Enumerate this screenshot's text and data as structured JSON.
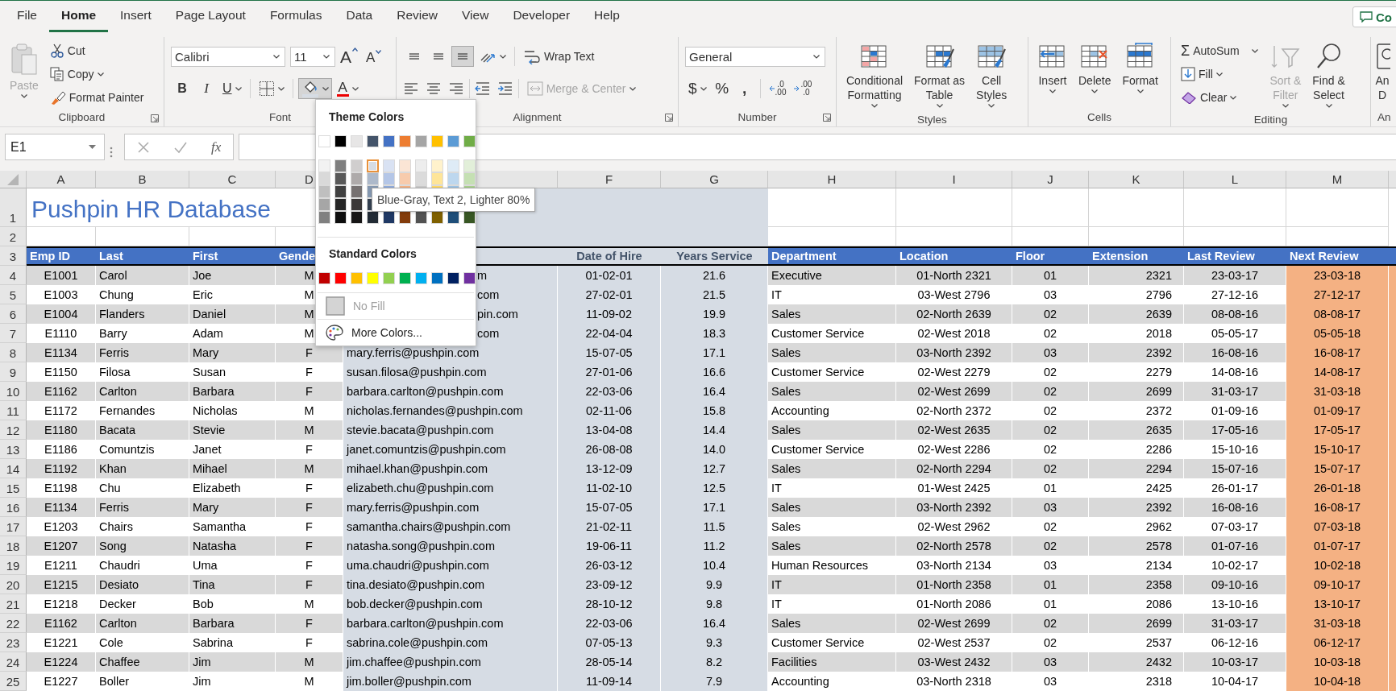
{
  "tabs": [
    {
      "label": "File",
      "selected": false
    },
    {
      "label": "Home",
      "selected": true
    },
    {
      "label": "Insert",
      "selected": false
    },
    {
      "label": "Page Layout",
      "selected": false
    },
    {
      "label": "Formulas",
      "selected": false
    },
    {
      "label": "Data",
      "selected": false
    },
    {
      "label": "Review",
      "selected": false
    },
    {
      "label": "View",
      "selected": false
    },
    {
      "label": "Developer",
      "selected": false
    },
    {
      "label": "Help",
      "selected": false
    }
  ],
  "comments_button": "Co",
  "clipboard": {
    "label": "Clipboard",
    "paste": {
      "label": "Paste",
      "disabled": true
    },
    "cut": "Cut",
    "copy": "Copy",
    "format_painter": "Format Painter"
  },
  "font": {
    "label": "Font",
    "font_name": "Calibri",
    "font_size": "11",
    "grow": "A",
    "shrink": "A",
    "bold": "B",
    "italic": "I",
    "underline": "U",
    "fill_color": {
      "pressed": true
    },
    "font_color": "A"
  },
  "alignment": {
    "label": "Alignment",
    "vertical": [
      {
        "selected": false
      },
      {
        "selected": false
      },
      {
        "selected": true
      }
    ],
    "wrap_text": "Wrap Text",
    "merge": {
      "label": "Merge & Center",
      "disabled": true
    }
  },
  "number": {
    "label": "Number",
    "format": "General",
    "currency": "$",
    "percent": "%",
    "comma": ",",
    "decimals": [
      {
        "top": ".0",
        "bottom": ".00"
      },
      {
        "top": ".00",
        "bottom": ".0"
      }
    ]
  },
  "styles": {
    "label": "Styles",
    "buttons": [
      {
        "lines": [
          "Conditional",
          "Formatting"
        ]
      },
      {
        "lines": [
          "Format as",
          "Table"
        ]
      },
      {
        "lines": [
          "Cell",
          "Styles"
        ]
      }
    ]
  },
  "cells": {
    "label": "Cells",
    "buttons": [
      "Insert",
      "Delete",
      "Format"
    ]
  },
  "editing": {
    "label": "Editing",
    "sigma": "Σ",
    "autosum": "AutoSum",
    "fill": "Fill",
    "clear": "Clear",
    "sort": {
      "lines": [
        "Sort &",
        "Filter"
      ],
      "disabled": true
    },
    "find": {
      "lines": [
        "Find &",
        "Select"
      ],
      "disabled": false
    }
  },
  "analyze": {
    "lines": [
      "An",
      "D"
    ],
    "label": "An"
  },
  "formula_bar": {
    "name_box": "E1",
    "fx": "fx"
  },
  "sheet": {
    "columns": [
      {
        "letter": "A"
      },
      {
        "letter": "B"
      },
      {
        "letter": "C"
      },
      {
        "letter": "D"
      },
      {
        "kind": "filled",
        "color": "#d6dce4"
      },
      {
        "letter": "F",
        "kind": "filled",
        "color": "#d6dce4"
      },
      {
        "letter": "G",
        "kind": "filled",
        "color": "#d6dce4"
      },
      {
        "letter": "H"
      },
      {
        "letter": "I"
      },
      {
        "letter": "J"
      },
      {
        "letter": "K"
      },
      {
        "letter": "L"
      },
      {
        "letter": "M",
        "kind": "highlighted",
        "color": "#f4b183"
      }
    ],
    "rows": [
      {
        "number": "1",
        "kind": "title",
        "title": "Pushpin HR Database"
      },
      {
        "number": "2",
        "kind": "blank"
      },
      {
        "number": "3",
        "kind": "header",
        "cells_before_menu": [
          "Emp ID",
          "Last",
          "First",
          "Gende"
        ],
        "cells_after_menu": [
          "Date of Hire",
          "Years Service",
          "Department",
          "Location",
          "Floor",
          "Extension",
          "Last Review",
          "Next Review"
        ]
      },
      {
        "number": "4",
        "kind": "data",
        "shaded": true,
        "cells": [
          "E1001",
          "Carol",
          "Joe",
          "M",
          {
            "covered": true,
            "text": "m"
          },
          "01-02-01",
          "21.6",
          "Executive",
          "01-North 2321",
          "01",
          "2321",
          "23-03-17",
          "23-03-18"
        ]
      },
      {
        "number": "5",
        "kind": "data",
        "shaded": false,
        "cells": [
          "E1003",
          "Chung",
          "Eric",
          "M",
          {
            "covered": true,
            "text": "com"
          },
          "27-02-01",
          "21.5",
          "IT",
          "03-West 2796",
          "03",
          "2796",
          "27-12-16",
          "27-12-17"
        ]
      },
      {
        "number": "6",
        "kind": "data",
        "shaded": true,
        "cells": [
          "E1004",
          "Flanders",
          "Daniel",
          "M",
          {
            "covered": true,
            "text": "pin.com"
          },
          "11-09-02",
          "19.9",
          "Sales",
          "02-North 2639",
          "02",
          "2639",
          "08-08-16",
          "08-08-17"
        ]
      },
      {
        "number": "7",
        "kind": "data",
        "shaded": false,
        "cells": [
          "E1110",
          "Barry",
          "Adam",
          "M",
          {
            "covered": true,
            "text": "com"
          },
          "22-04-04",
          "18.3",
          "Customer Service",
          "02-West 2018",
          "02",
          "2018",
          "05-05-17",
          "05-05-18"
        ]
      },
      {
        "number": "8",
        "kind": "data",
        "shaded": true,
        "cells": [
          "E1134",
          "Ferris",
          "Mary",
          "F",
          "mary.ferris@pushpin.com",
          "15-07-05",
          "17.1",
          "Sales",
          "03-North 2392",
          "03",
          "2392",
          "16-08-16",
          "16-08-17"
        ]
      },
      {
        "number": "9",
        "kind": "data",
        "shaded": false,
        "cells": [
          "E1150",
          "Filosa",
          "Susan",
          "F",
          "susan.filosa@pushpin.com",
          "27-01-06",
          "16.6",
          "Customer Service",
          "02-West 2279",
          "02",
          "2279",
          "14-08-16",
          "14-08-17"
        ]
      },
      {
        "number": "10",
        "kind": "data",
        "shaded": true,
        "cells": [
          "E1162",
          "Carlton",
          "Barbara",
          "F",
          "barbara.carlton@pushpin.com",
          "22-03-06",
          "16.4",
          "Sales",
          "02-West 2699",
          "02",
          "2699",
          "31-03-17",
          "31-03-18"
        ]
      },
      {
        "number": "11",
        "kind": "data",
        "shaded": false,
        "cells": [
          "E1172",
          "Fernandes",
          "Nicholas",
          "M",
          "nicholas.fernandes@pushpin.com",
          "02-11-06",
          "15.8",
          "Accounting",
          "02-North 2372",
          "02",
          "2372",
          "01-09-16",
          "01-09-17"
        ]
      },
      {
        "number": "12",
        "kind": "data",
        "shaded": true,
        "cells": [
          "E1180",
          "Bacata",
          "Stevie",
          "M",
          "stevie.bacata@pushpin.com",
          "13-04-08",
          "14.4",
          "Sales",
          "02-West 2635",
          "02",
          "2635",
          "17-05-16",
          "17-05-17"
        ]
      },
      {
        "number": "13",
        "kind": "data",
        "shaded": false,
        "cells": [
          "E1186",
          "Comuntzis",
          "Janet",
          "F",
          "janet.comuntzis@pushpin.com",
          "26-08-08",
          "14.0",
          "Customer Service",
          "02-West 2286",
          "02",
          "2286",
          "15-10-16",
          "15-10-17"
        ]
      },
      {
        "number": "14",
        "kind": "data",
        "shaded": true,
        "cells": [
          "E1192",
          "Khan",
          "Mihael",
          "M",
          "mihael.khan@pushpin.com",
          "13-12-09",
          "12.7",
          "Sales",
          "02-North 2294",
          "02",
          "2294",
          "15-07-16",
          "15-07-17"
        ]
      },
      {
        "number": "15",
        "kind": "data",
        "shaded": false,
        "cells": [
          "E1198",
          "Chu",
          "Elizabeth",
          "F",
          "elizabeth.chu@pushpin.com",
          "11-02-10",
          "12.5",
          "IT",
          "01-West 2425",
          "01",
          "2425",
          "26-01-17",
          "26-01-18"
        ]
      },
      {
        "number": "16",
        "kind": "data",
        "shaded": true,
        "cells": [
          "E1134",
          "Ferris",
          "Mary",
          "F",
          "mary.ferris@pushpin.com",
          "15-07-05",
          "17.1",
          "Sales",
          "03-North 2392",
          "03",
          "2392",
          "16-08-16",
          "16-08-17"
        ]
      },
      {
        "number": "17",
        "kind": "data",
        "shaded": false,
        "cells": [
          "E1203",
          "Chairs",
          "Samantha",
          "F",
          "samantha.chairs@pushpin.com",
          "21-02-11",
          "11.5",
          "Sales",
          "02-West 2962",
          "02",
          "2962",
          "07-03-17",
          "07-03-18"
        ]
      },
      {
        "number": "18",
        "kind": "data",
        "shaded": true,
        "cells": [
          "E1207",
          "Song",
          "Natasha",
          "F",
          "natasha.song@pushpin.com",
          "19-06-11",
          "11.2",
          "Sales",
          "02-North 2578",
          "02",
          "2578",
          "01-07-16",
          "01-07-17"
        ]
      },
      {
        "number": "19",
        "kind": "data",
        "shaded": false,
        "cells": [
          "E1211",
          "Chaudri",
          "Uma",
          "F",
          "uma.chaudri@pushpin.com",
          "26-03-12",
          "10.4",
          "Human Resources",
          "03-North 2134",
          "03",
          "2134",
          "10-02-17",
          "10-02-18"
        ]
      },
      {
        "number": "20",
        "kind": "data",
        "shaded": true,
        "cells": [
          "E1215",
          "Desiato",
          "Tina",
          "F",
          "tina.desiato@pushpin.com",
          "23-09-12",
          "9.9",
          "IT",
          "01-North 2358",
          "01",
          "2358",
          "09-10-16",
          "09-10-17"
        ]
      },
      {
        "number": "21",
        "kind": "data",
        "shaded": false,
        "cells": [
          "E1218",
          "Decker",
          "Bob",
          "M",
          "bob.decker@pushpin.com",
          "28-10-12",
          "9.8",
          "IT",
          "01-North 2086",
          "01",
          "2086",
          "13-10-16",
          "13-10-17"
        ]
      },
      {
        "number": "22",
        "kind": "data",
        "shaded": true,
        "cells": [
          "E1162",
          "Carlton",
          "Barbara",
          "F",
          "barbara.carlton@pushpin.com",
          "22-03-06",
          "16.4",
          "Sales",
          "02-West 2699",
          "02",
          "2699",
          "31-03-17",
          "31-03-18"
        ]
      },
      {
        "number": "23",
        "kind": "data",
        "shaded": false,
        "cells": [
          "E1221",
          "Cole",
          "Sabrina",
          "F",
          "sabrina.cole@pushpin.com",
          "07-05-13",
          "9.3",
          "Customer Service",
          "02-West 2537",
          "02",
          "2537",
          "06-12-16",
          "06-12-17"
        ]
      },
      {
        "number": "24",
        "kind": "data",
        "shaded": true,
        "cells": [
          "E1224",
          "Chaffee",
          "Jim",
          "M",
          "jim.chaffee@pushpin.com",
          "28-05-14",
          "8.2",
          "Facilities",
          "03-West 2432",
          "03",
          "2432",
          "10-03-17",
          "10-03-18"
        ]
      },
      {
        "number": "25",
        "kind": "data",
        "shaded": false,
        "cells": [
          "E1227",
          "Boller",
          "Jim",
          "M",
          "jim.boller@pushpin.com",
          "11-09-14",
          "7.9",
          "Accounting",
          "03-North 2318",
          "03",
          "2318",
          "10-04-17",
          "10-04-18"
        ]
      }
    ]
  },
  "color_menu": {
    "theme_heading": "Theme Colors",
    "theme": [
      {
        "color": "#ffffff",
        "selected": false
      },
      {
        "color": "#000000",
        "selected": false
      },
      {
        "color": "#e7e6e6",
        "selected": false
      },
      {
        "color": "#44546a",
        "selected": false
      },
      {
        "color": "#4472c4",
        "selected": false
      },
      {
        "color": "#ed7d31",
        "selected": false
      },
      {
        "color": "#a5a5a5",
        "selected": false
      },
      {
        "color": "#ffc000",
        "selected": false
      },
      {
        "color": "#5b9bd5",
        "selected": false
      },
      {
        "color": "#70ad47",
        "selected": false
      }
    ],
    "shade_rows": [
      [
        {
          "color": "#f2f2f2",
          "selected": false
        },
        {
          "color": "#7f7f7f",
          "selected": false
        },
        {
          "color": "#d0cece",
          "selected": false
        },
        {
          "color": "#d6dce4",
          "selected": true
        },
        {
          "color": "#d9e2f3",
          "selected": false
        },
        {
          "color": "#fbe5d5",
          "selected": false
        },
        {
          "color": "#ededed",
          "selected": false
        },
        {
          "color": "#fff2cc",
          "selected": false
        },
        {
          "color": "#deebf6",
          "selected": false
        },
        {
          "color": "#e2efd9",
          "selected": false
        }
      ],
      [
        {
          "color": "#d9d9d9",
          "selected": false
        },
        {
          "color": "#595959",
          "selected": false
        },
        {
          "color": "#aeaaaa",
          "selected": false
        },
        {
          "color": "#adb9ca",
          "selected": false
        },
        {
          "color": "#b4c6e7",
          "selected": false
        },
        {
          "color": "#f7cbac",
          "selected": false
        },
        {
          "color": "#dbdbdb",
          "selected": false
        },
        {
          "color": "#fee599",
          "selected": false
        },
        {
          "color": "#bdd7ee",
          "selected": false
        },
        {
          "color": "#c5e0b3",
          "selected": false
        }
      ],
      [
        {
          "color": "#bfbfbf",
          "selected": false
        },
        {
          "color": "#404040",
          "selected": false
        },
        {
          "color": "#767171",
          "selected": false
        },
        {
          "color": "#8497b0",
          "selected": false
        },
        {
          "color": "#8eaadb",
          "selected": false
        },
        {
          "color": "#f4b183",
          "selected": false
        },
        {
          "color": "#c9c9c9",
          "selected": false
        },
        {
          "color": "#ffd965",
          "selected": false
        },
        {
          "color": "#9cc3e5",
          "selected": false
        },
        {
          "color": "#a8d08d",
          "selected": false
        }
      ],
      [
        {
          "color": "#a6a6a6",
          "selected": false
        },
        {
          "color": "#262626",
          "selected": false
        },
        {
          "color": "#3b3838",
          "selected": false
        },
        {
          "color": "#333f4f",
          "selected": false
        }
      ],
      [
        {
          "color": "#808080",
          "selected": false
        },
        {
          "color": "#0d0d0d",
          "selected": false
        },
        {
          "color": "#171616",
          "selected": false
        },
        {
          "color": "#222b35",
          "selected": false
        },
        {
          "color": "#1f3864",
          "selected": false
        },
        {
          "color": "#833c0b",
          "selected": false
        },
        {
          "color": "#525252",
          "selected": false
        },
        {
          "color": "#7f6000",
          "selected": false
        },
        {
          "color": "#1e4e79",
          "selected": false
        },
        {
          "color": "#375623",
          "selected": false
        }
      ]
    ],
    "standard_heading": "Standard Colors",
    "standard": [
      {
        "color": "#c00000",
        "selected": false
      },
      {
        "color": "#ff0000",
        "selected": false
      },
      {
        "color": "#ffc000",
        "selected": false
      },
      {
        "color": "#ffff00",
        "selected": false
      },
      {
        "color": "#92d050",
        "selected": false
      },
      {
        "color": "#00b050",
        "selected": false
      },
      {
        "color": "#00b0f0",
        "selected": false
      },
      {
        "color": "#0070c0",
        "selected": false
      },
      {
        "color": "#002060",
        "selected": false
      },
      {
        "color": "#7030a0",
        "selected": false
      }
    ],
    "no_fill": {
      "label": "No Fill",
      "disabled": true
    },
    "more_colors": "More Colors..."
  },
  "tooltip": "Blue-Gray, Text 2, Lighter 80%"
}
